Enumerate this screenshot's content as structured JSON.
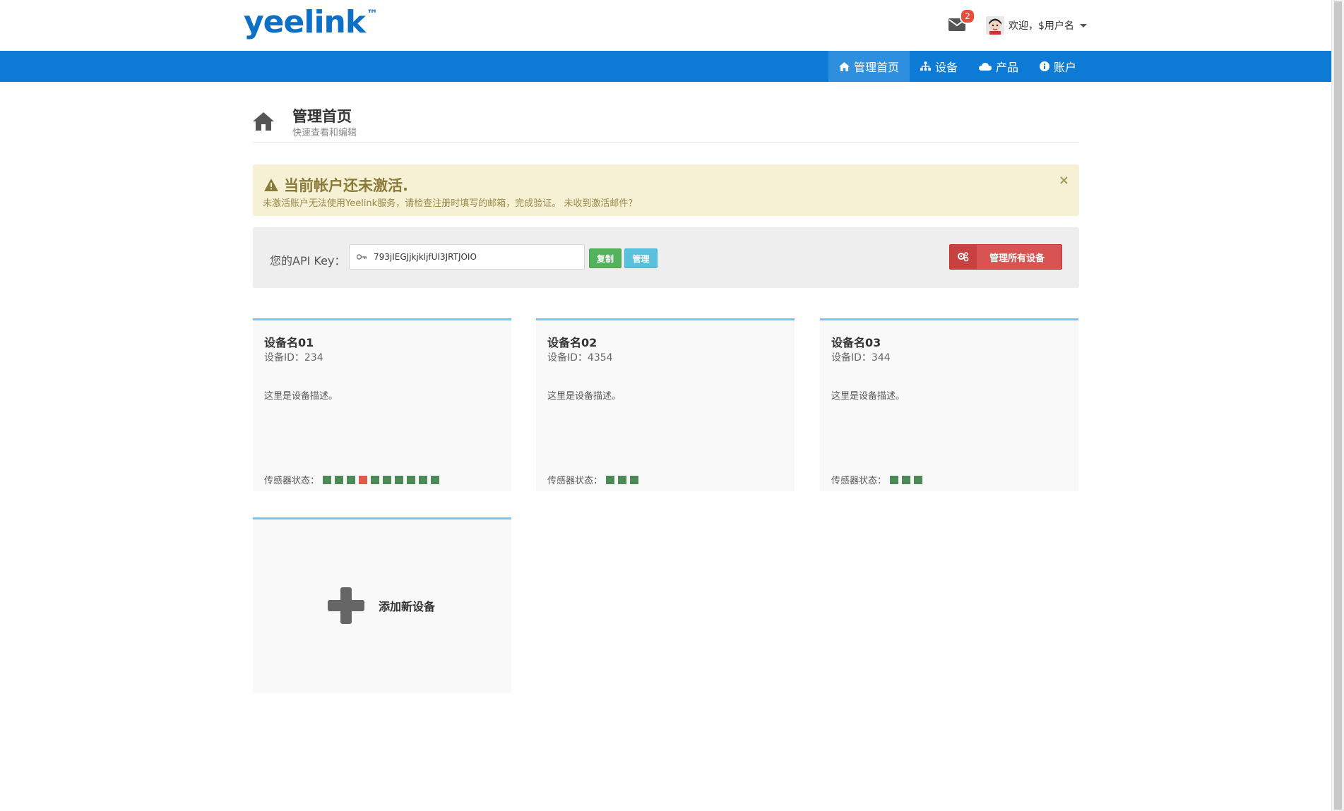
{
  "brand": {
    "logo": "yeelink",
    "tm": "™",
    "logo_color": "#0d6fc6"
  },
  "header": {
    "mail_badge": "2",
    "welcome": "欢迎，$用户名"
  },
  "nav": {
    "bg_color": "#0d7ad6",
    "items": [
      {
        "label": "管理首页",
        "icon": "home-icon",
        "active": true
      },
      {
        "label": "设备",
        "icon": "sitemap-icon",
        "active": false
      },
      {
        "label": "产品",
        "icon": "cloud-icon",
        "active": false
      },
      {
        "label": "账户",
        "icon": "info-icon",
        "active": false
      }
    ]
  },
  "page": {
    "title": "管理首页",
    "subtitle": "快速查看和编辑"
  },
  "alert": {
    "title": "当前帐户还未激活.",
    "text": "未激活账户无法使用Yeelink服务，请检查注册时填写的邮箱，完成验证。 未收到激活邮件？",
    "close": "×"
  },
  "api": {
    "label": "您的API Key：",
    "key": "793jIEGJjkjkljfUI3JRTJOIO",
    "copy_label": "复制",
    "manage_label": "管理",
    "manage_all_label": "管理所有设备"
  },
  "sensor_colors": {
    "ok": "#4e8a57",
    "bad": "#e25a4c"
  },
  "devices": [
    {
      "name": "设备名01",
      "id": "设备ID：234",
      "desc": "这里是设备描述。",
      "sensor_label": "传感器状态：",
      "sensors": [
        "ok",
        "ok",
        "ok",
        "bad",
        "ok",
        "ok",
        "ok",
        "ok",
        "ok",
        "ok"
      ]
    },
    {
      "name": "设备名02",
      "id": "设备ID：4354",
      "desc": "这里是设备描述。",
      "sensor_label": "传感器状态：",
      "sensors": [
        "ok",
        "ok",
        "ok"
      ]
    },
    {
      "name": "设备名03",
      "id": "设备ID：344",
      "desc": "这里是设备描述。",
      "sensor_label": "传感器状态：",
      "sensors": [
        "ok",
        "ok",
        "ok"
      ]
    }
  ],
  "add_device": {
    "label": "添加新设备"
  }
}
